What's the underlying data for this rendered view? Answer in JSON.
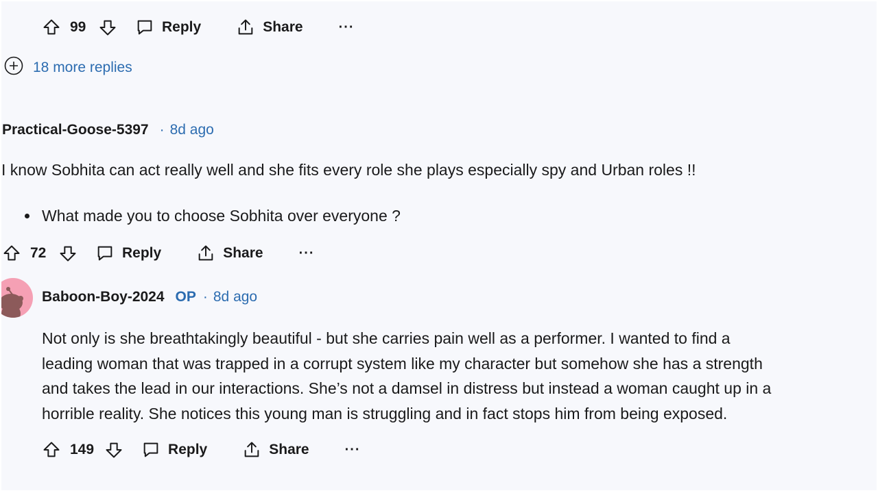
{
  "comment_top": {
    "score": "99",
    "reply_label": "Reply",
    "share_label": "Share",
    "more_label": "···"
  },
  "more_replies": {
    "label": "18 more replies"
  },
  "comment_1": {
    "author": "Practical-Goose-5397",
    "separator": "·",
    "time": "8d ago",
    "text": "I know Sobhita can act really well and she fits every role she plays especially spy and Urban roles !!",
    "bullets": [
      "What made you to choose Sobhita over everyone ?"
    ],
    "score": "72",
    "reply_label": "Reply",
    "share_label": "Share",
    "more_label": "···"
  },
  "comment_2": {
    "author": "Baboon-Boy-2024",
    "op_badge": "OP",
    "separator": "·",
    "time": "8d ago",
    "lines": [
      "Not only is she breathtakingly beautiful - but she carries pain well as a performer. I wanted to find a",
      "leading woman that was trapped in a corrupt system like my character but somehow she has a strength",
      "and takes the lead in our interactions. She’s not a damsel in distress but instead a woman caught up in a",
      "horrible reality. She notices this young man is struggling and in fact stops him from being exposed."
    ],
    "score": "149",
    "reply_label": "Reply",
    "share_label": "Share",
    "more_label": "···"
  },
  "colors": {
    "link": "#2c6cb0",
    "text": "#1a1a1b",
    "background": "#f7f8fc",
    "avatar": "#f5a0b4"
  },
  "icons": [
    "upvote-icon",
    "downvote-icon",
    "reply-icon",
    "share-icon",
    "more-icon",
    "expand-icon",
    "avatar-snoo-icon"
  ]
}
